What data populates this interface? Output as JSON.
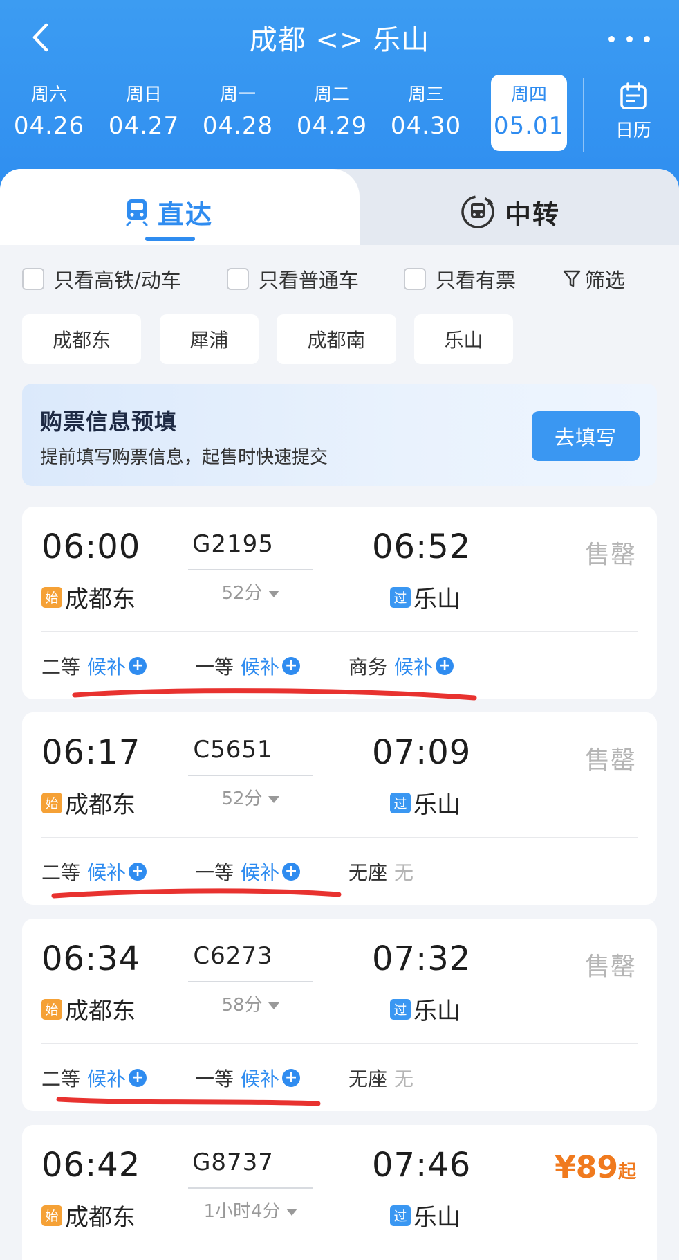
{
  "header": {
    "title": "成都 <> 乐山",
    "calendar_label": "日历"
  },
  "dates": [
    {
      "dow": "周六",
      "day": "04.26"
    },
    {
      "dow": "周日",
      "day": "04.27"
    },
    {
      "dow": "周一",
      "day": "04.28"
    },
    {
      "dow": "周二",
      "day": "04.29"
    },
    {
      "dow": "周三",
      "day": "04.30"
    },
    {
      "dow": "周四",
      "day": "05.01"
    }
  ],
  "selected_date": "05.01",
  "tabs": {
    "direct": "直达",
    "transfer": "中转"
  },
  "filters": {
    "high_speed": "只看高铁/动车",
    "normal": "只看普通车",
    "available": "只看有票",
    "filter_btn": "筛选"
  },
  "stations": [
    "成都东",
    "犀浦",
    "成都南",
    "乐山"
  ],
  "prefill": {
    "title": "购票信息预填",
    "subtitle": "提前填写购票信息，起售时快速提交",
    "button": "去填写"
  },
  "tags": {
    "start": "始",
    "pass": "过"
  },
  "trains": [
    {
      "dep_time": "06:00",
      "dep_station": "成都东",
      "train_no": "G2195",
      "duration": "52分",
      "arr_time": "06:52",
      "arr_station": "乐山",
      "status": "售罄",
      "seats": [
        {
          "class": "二等",
          "state": "候补"
        },
        {
          "class": "一等",
          "state": "候补"
        },
        {
          "class": "商务",
          "state": "候补"
        }
      ]
    },
    {
      "dep_time": "06:17",
      "dep_station": "成都东",
      "train_no": "C5651",
      "duration": "52分",
      "arr_time": "07:09",
      "arr_station": "乐山",
      "status": "售罄",
      "seats": [
        {
          "class": "二等",
          "state": "候补"
        },
        {
          "class": "一等",
          "state": "候补"
        },
        {
          "class": "无座",
          "state": "无"
        }
      ]
    },
    {
      "dep_time": "06:34",
      "dep_station": "成都东",
      "train_no": "C6273",
      "duration": "58分",
      "arr_time": "07:32",
      "arr_station": "乐山",
      "status": "售罄",
      "seats": [
        {
          "class": "二等",
          "state": "候补"
        },
        {
          "class": "一等",
          "state": "候补"
        },
        {
          "class": "无座",
          "state": "无"
        }
      ]
    },
    {
      "dep_time": "06:42",
      "dep_station": "成都东",
      "train_no": "G8737",
      "duration": "1小时4分",
      "arr_time": "07:46",
      "arr_station": "乐山",
      "price": "¥89",
      "price_suffix": "起"
    }
  ],
  "colors": {
    "primary": "#2f8cf0",
    "header_bg": "#3c9cf2",
    "price": "#f07a1e",
    "sold_out": "#b5b5b5",
    "annotation_red": "#e8322f"
  }
}
